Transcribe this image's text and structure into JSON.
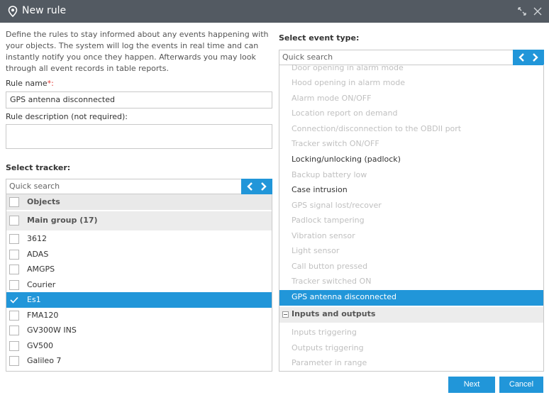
{
  "window": {
    "title": "New rule"
  },
  "intro": "Define the rules to stay informed about any events happening with your objects. The system will log the events in real time and can instantly notify you once they happen. Afterwards you may look through all event records in table reports.",
  "rule_name": {
    "label": "Rule name",
    "required_mark": "*:",
    "value": "GPS antenna disconnected"
  },
  "rule_description": {
    "label": "Rule description (not required):",
    "value": ""
  },
  "tracker": {
    "section_title": "Select tracker:",
    "search_placeholder": "Quick search",
    "header": "Objects",
    "group": "Main group (17)",
    "items": [
      {
        "name": "3612",
        "checked": false
      },
      {
        "name": "ADAS",
        "checked": false
      },
      {
        "name": "AMGPS",
        "checked": false
      },
      {
        "name": "Courier",
        "checked": false
      },
      {
        "name": "Es1",
        "checked": true
      },
      {
        "name": "FMA120",
        "checked": false
      },
      {
        "name": "GV300W INS",
        "checked": false
      },
      {
        "name": "GV500",
        "checked": false
      },
      {
        "name": "Galileo 7",
        "checked": false
      }
    ]
  },
  "event": {
    "section_title": "Select event type:",
    "search_placeholder": "Quick search",
    "items": [
      {
        "name": "Door opening in alarm mode",
        "state": "disabled"
      },
      {
        "name": "Hood opening in alarm mode",
        "state": "disabled"
      },
      {
        "name": "Alarm mode ON/OFF",
        "state": "disabled"
      },
      {
        "name": "Location report on demand",
        "state": "disabled"
      },
      {
        "name": "Connection/disconnection to the OBDII port",
        "state": "disabled"
      },
      {
        "name": "Tracker switch ON/OFF",
        "state": "disabled"
      },
      {
        "name": "Locking/unlocking (padlock)",
        "state": "available"
      },
      {
        "name": "Backup battery low",
        "state": "disabled"
      },
      {
        "name": "Case intrusion",
        "state": "available"
      },
      {
        "name": "GPS signal lost/recover",
        "state": "disabled"
      },
      {
        "name": "Padlock tampering",
        "state": "disabled"
      },
      {
        "name": "Vibration sensor",
        "state": "disabled"
      },
      {
        "name": "Light sensor",
        "state": "disabled"
      },
      {
        "name": "Call button pressed",
        "state": "disabled"
      },
      {
        "name": "Tracker switched ON",
        "state": "disabled"
      },
      {
        "name": "GPS antenna disconnected",
        "state": "selected"
      },
      {
        "name": "Inputs and outputs",
        "state": "category"
      },
      {
        "name": "Inputs triggering",
        "state": "disabled"
      },
      {
        "name": "Outputs triggering",
        "state": "disabled"
      },
      {
        "name": "Parameter in range",
        "state": "disabled"
      }
    ]
  },
  "buttons": {
    "next": "Next",
    "cancel": "Cancel"
  },
  "colors": {
    "accent": "#2196d9",
    "titlebar": "#535a62",
    "required": "#e53935"
  }
}
